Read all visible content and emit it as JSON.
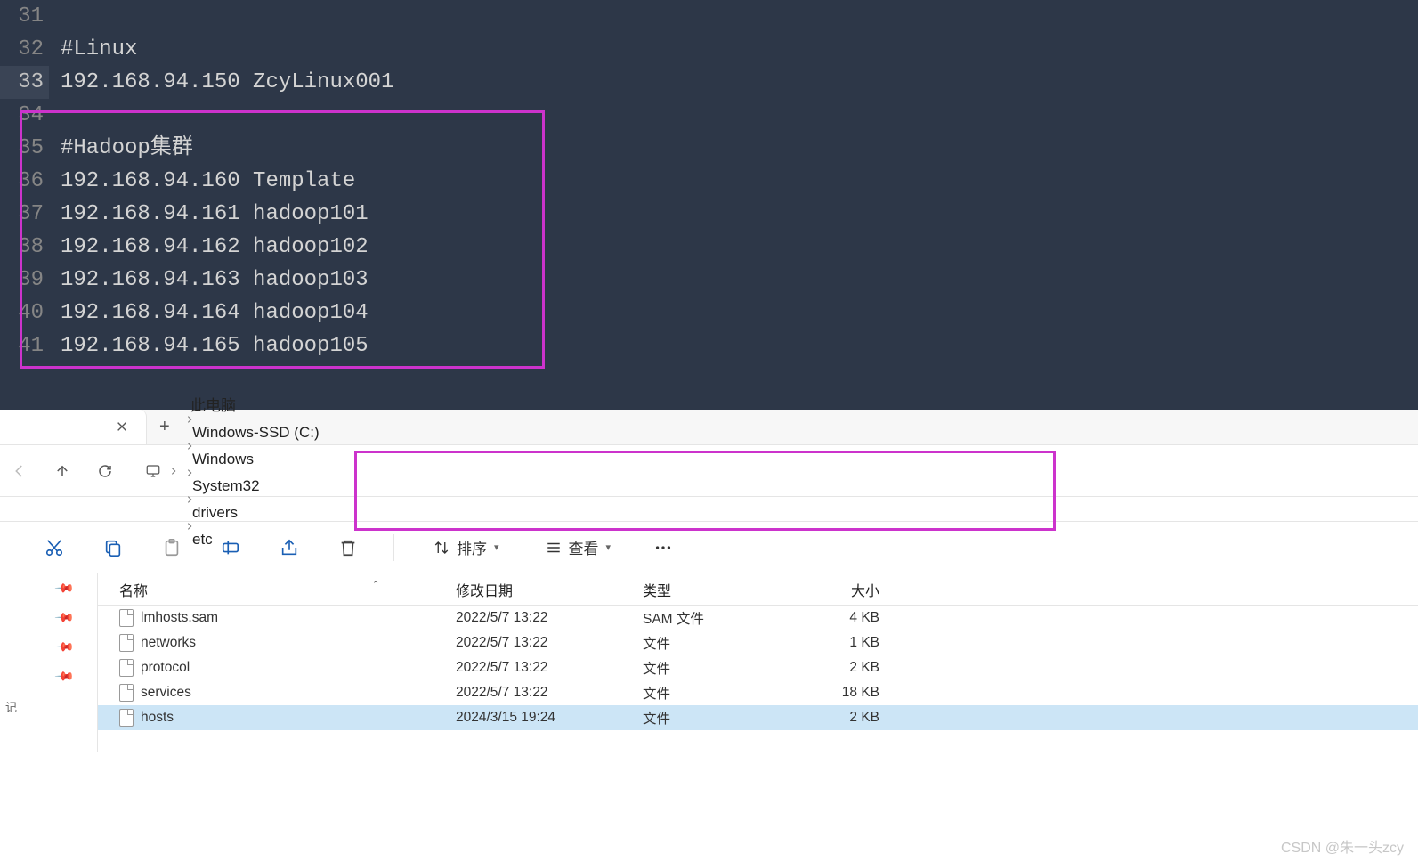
{
  "editor": {
    "startLine": 31,
    "currentLine": 33,
    "lines": [
      "",
      "#Linux",
      "192.168.94.150 ZcyLinux001",
      "",
      "#Hadoop集群",
      "192.168.94.160 Template",
      "192.168.94.161 hadoop101",
      "192.168.94.162 hadoop102",
      "192.168.94.163 hadoop103",
      "192.168.94.164 hadoop104",
      "192.168.94.165 hadoop105"
    ]
  },
  "explorer": {
    "breadcrumb": [
      "此电脑",
      "Windows-SSD (C:)",
      "Windows",
      "System32",
      "drivers",
      "etc"
    ],
    "toolbar": {
      "sort_label": "排序",
      "view_label": "查看"
    },
    "columns": {
      "name": "名称",
      "date": "修改日期",
      "type": "类型",
      "size": "大小"
    },
    "files": [
      {
        "name": "lmhosts.sam",
        "date": "2022/5/7 13:22",
        "type": "SAM 文件",
        "size": "4 KB",
        "selected": false
      },
      {
        "name": "networks",
        "date": "2022/5/7 13:22",
        "type": "文件",
        "size": "1 KB",
        "selected": false
      },
      {
        "name": "protocol",
        "date": "2022/5/7 13:22",
        "type": "文件",
        "size": "2 KB",
        "selected": false
      },
      {
        "name": "services",
        "date": "2022/5/7 13:22",
        "type": "文件",
        "size": "18 KB",
        "selected": false
      },
      {
        "name": "hosts",
        "date": "2024/3/15 19:24",
        "type": "文件",
        "size": "2 KB",
        "selected": true
      }
    ],
    "sidebar_label": "记"
  },
  "watermark": "CSDN @朱一头zcy"
}
